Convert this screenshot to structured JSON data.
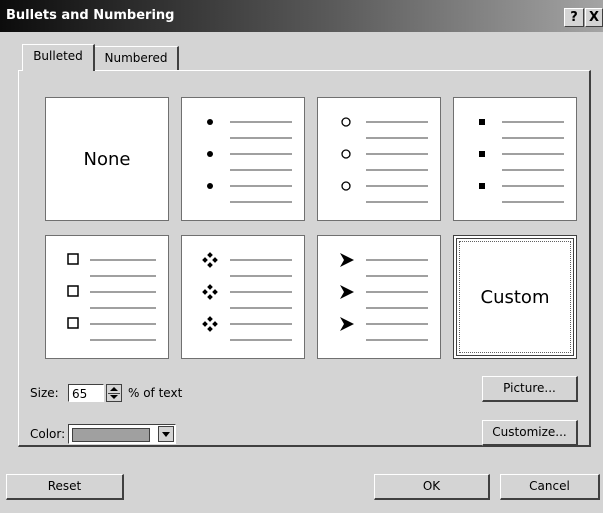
{
  "window": {
    "title": "Bullets and Numbering",
    "help_label": "?",
    "close_label": "X"
  },
  "tabs": [
    {
      "label": "Bulleted",
      "selected": true
    },
    {
      "label": "Numbered",
      "selected": false
    }
  ],
  "bullet_styles": [
    {
      "label": "None",
      "bullet": "none"
    },
    {
      "label": "",
      "bullet": "filled-dot"
    },
    {
      "label": "",
      "bullet": "hollow-circle"
    },
    {
      "label": "",
      "bullet": "filled-square"
    },
    {
      "label": "",
      "bullet": "hollow-square"
    },
    {
      "label": "",
      "bullet": "four-diamond"
    },
    {
      "label": "",
      "bullet": "arrowhead"
    },
    {
      "label": "Custom",
      "bullet": "custom",
      "selected": true
    }
  ],
  "size": {
    "label": "Size:",
    "value": "65",
    "unit": "% of text"
  },
  "color": {
    "label": "Color:",
    "value": "#a0a0a0"
  },
  "buttons": {
    "picture": "Picture...",
    "customize": "Customize...",
    "reset": "Reset",
    "ok": "OK",
    "cancel": "Cancel"
  },
  "colors": {
    "dialog_bg": "#d4d4d4",
    "title_start": "#0c0c0c",
    "title_end": "#a4a4a4"
  }
}
